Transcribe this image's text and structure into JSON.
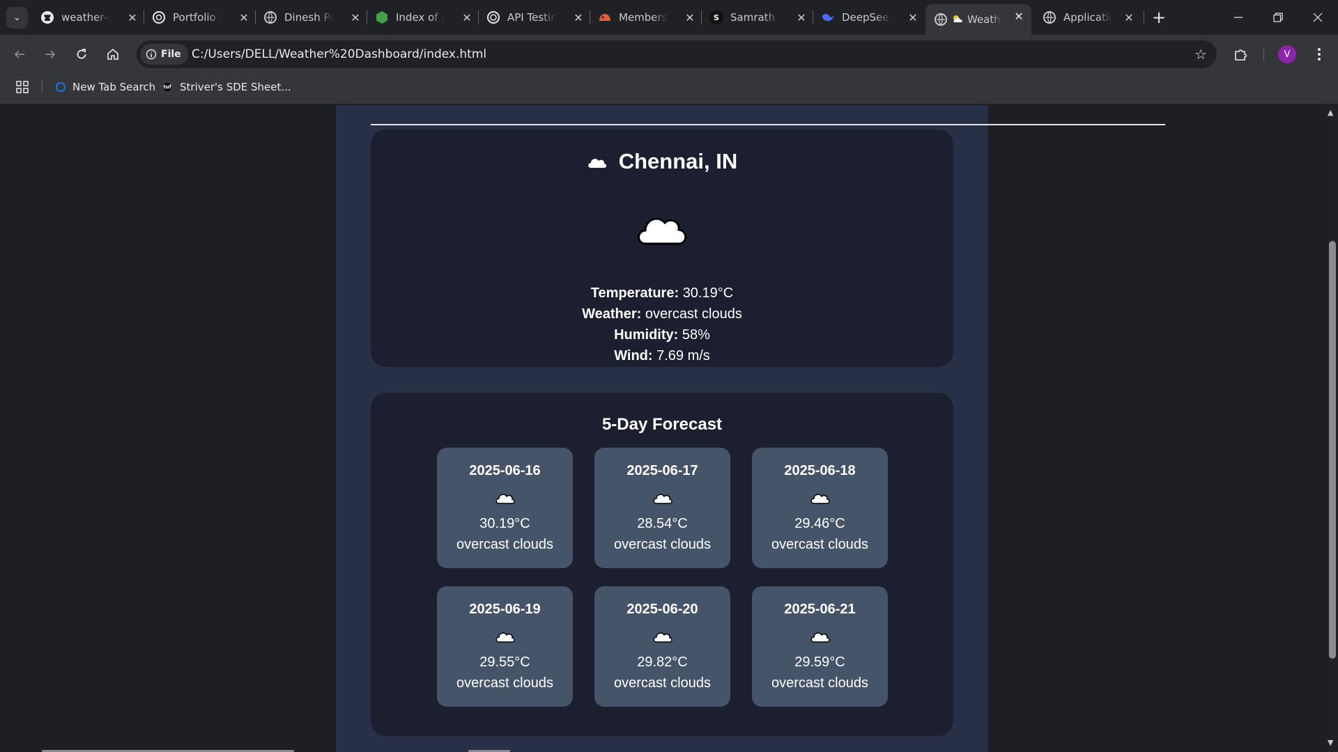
{
  "tabs": [
    {
      "title": "weather-dashboard",
      "icon": "github-icon"
    },
    {
      "title": "Portfolio Eval",
      "icon": "globe-icon"
    },
    {
      "title": "Dinesh Portfolio",
      "icon": "globe-icon"
    },
    {
      "title": "Index of /code",
      "icon": "node-icon"
    },
    {
      "title": "API Testing",
      "icon": "openai-icon"
    },
    {
      "title": "Members",
      "icon": "members-icon"
    },
    {
      "title": "Samrath Resume",
      "icon": "s-icon"
    },
    {
      "title": "DeepSeek",
      "icon": "deepseek-icon"
    },
    {
      "title": "Weather Dashboard",
      "icon": "weather-icon",
      "active": true
    },
    {
      "title": "Application",
      "icon": "globe-icon"
    }
  ],
  "address_bar": {
    "chip_label": "File",
    "url": "C:/Users/DELL/Weather%20Dashboard/index.html"
  },
  "profile": {
    "initial": "V"
  },
  "bookmarks": [
    {
      "label": "New Tab Search"
    },
    {
      "label": "Striver's SDE Sheet..."
    }
  ],
  "current_weather": {
    "city": "Chennai, IN",
    "temperature_label": "Temperature:",
    "temperature_value": "30.19°C",
    "weather_label": "Weather:",
    "weather_value": "overcast clouds",
    "humidity_label": "Humidity:",
    "humidity_value": "58%",
    "wind_label": "Wind:",
    "wind_value": "7.69 m/s"
  },
  "forecast": {
    "title": "5-Day Forecast",
    "days": [
      {
        "date": "2025-06-16",
        "temp": "30.19°C",
        "desc": "overcast clouds"
      },
      {
        "date": "2025-06-17",
        "temp": "28.54°C",
        "desc": "overcast clouds"
      },
      {
        "date": "2025-06-18",
        "temp": "29.46°C",
        "desc": "overcast clouds"
      },
      {
        "date": "2025-06-19",
        "temp": "29.55°C",
        "desc": "overcast clouds"
      },
      {
        "date": "2025-06-20",
        "temp": "29.82°C",
        "desc": "overcast clouds"
      },
      {
        "date": "2025-06-21",
        "temp": "29.59°C",
        "desc": "overcast clouds"
      }
    ]
  }
}
